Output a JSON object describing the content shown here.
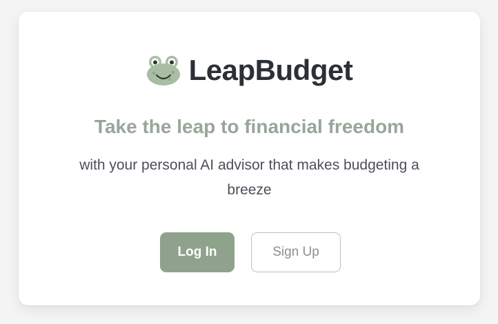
{
  "brand": {
    "name": "LeapBudget",
    "logo_icon": "frog-icon"
  },
  "hero": {
    "tagline": "Take the leap to financial freedom",
    "subtitle": "with your personal AI advisor that makes budgeting a breeze"
  },
  "actions": {
    "login_label": "Log In",
    "signup_label": "Sign Up"
  },
  "colors": {
    "accent": "#8fa38c",
    "tagline": "#9aa59a",
    "title": "#2b2f36",
    "body_text": "#4b4f58"
  }
}
